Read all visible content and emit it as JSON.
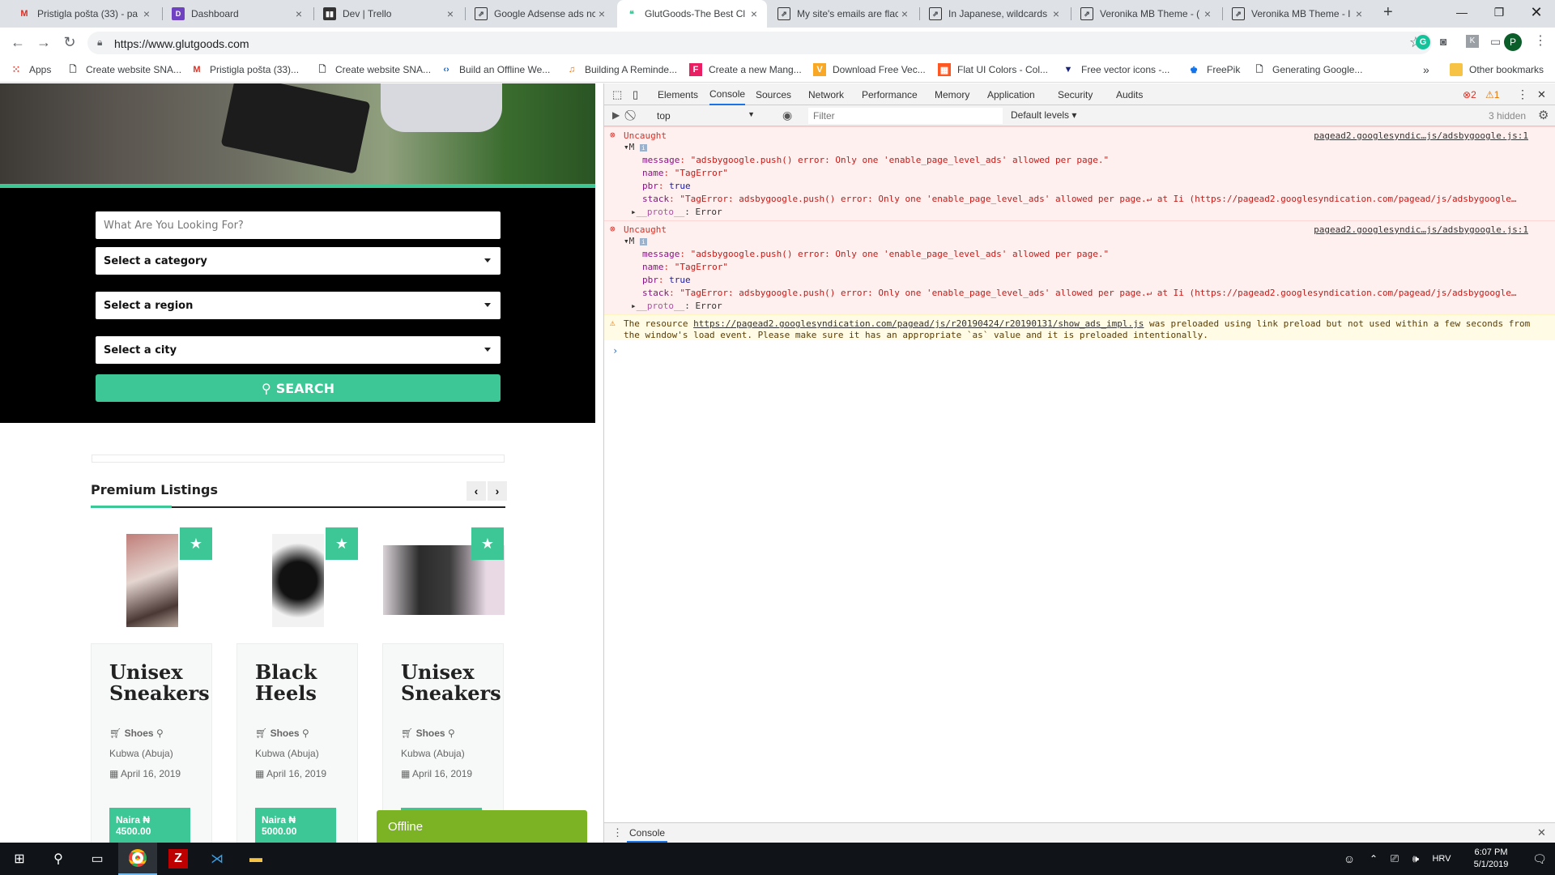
{
  "tabs": [
    {
      "title": "Pristigla pošta (33) - pa",
      "icon": "gmail-icon"
    },
    {
      "title": "Dashboard",
      "icon": "dashboard-icon"
    },
    {
      "title": "Dev | Trello",
      "icon": "trello-icon"
    },
    {
      "title": "Google Adsense ads nc",
      "icon": "stackexchange-icon"
    },
    {
      "title": "GlutGoods-The Best Cl",
      "icon": "glutgoods-icon"
    },
    {
      "title": "My site's emails are flac",
      "icon": "stackexchange-icon"
    },
    {
      "title": "In Japanese, wildcards a",
      "icon": "stackexchange-icon"
    },
    {
      "title": "Veronika MB Theme - (",
      "icon": "stackexchange-icon"
    },
    {
      "title": "Veronika MB Theme - I",
      "icon": "stackexchange-icon"
    }
  ],
  "browser": {
    "url": "https://www.glutgoods.com",
    "profile_initial": "P"
  },
  "bookmarks": [
    {
      "label": "Apps"
    },
    {
      "label": "Create website SNA..."
    },
    {
      "label": "Pristigla pošta (33)..."
    },
    {
      "label": "Create website SNA..."
    },
    {
      "label": "Build an Offline We..."
    },
    {
      "label": "Building A Reminde..."
    },
    {
      "label": "Create a new Mang..."
    },
    {
      "label": "Download Free Vec..."
    },
    {
      "label": "Flat UI Colors - Col..."
    },
    {
      "label": "Free vector icons -..."
    },
    {
      "label": "FreePik"
    },
    {
      "label": "Generating Google..."
    },
    {
      "label": "Other bookmarks"
    }
  ],
  "search": {
    "placeholder": "What Are You Looking For?",
    "category": "Select a category",
    "region": "Select a region",
    "city": "Select a city",
    "button": "SEARCH"
  },
  "premium": {
    "title": "Premium Listings",
    "cards": [
      {
        "title": "Unisex Sneakers",
        "category": "Shoes",
        "location": "Kubwa (Abuja)",
        "date": "April 16, 2019",
        "price": "Naira ₦ 4500.00"
      },
      {
        "title": "Black Heels",
        "category": "Shoes",
        "location": "Kubwa (Abuja)",
        "date": "April 16, 2019",
        "price": "Naira ₦ 5000.00"
      },
      {
        "title": "Unisex Sneakers",
        "category": "Shoes",
        "location": "Kubwa (Abuja)",
        "date": "April 16, 2019",
        "price": ""
      }
    ]
  },
  "offline": "Offline",
  "devtools": {
    "tabs": [
      "Elements",
      "Console",
      "Sources",
      "Network",
      "Performance",
      "Memory",
      "Application",
      "Security",
      "Audits"
    ],
    "errors_count": "2",
    "warnings_count": "1",
    "context": "top",
    "filter_placeholder": "Filter",
    "levels": "Default levels",
    "hidden": "3 hidden",
    "drawer_tab": "Console",
    "errors": [
      {
        "label": "Uncaught",
        "source": "pagead2.googlesyndic…js/adsbygoogle.js:1",
        "obj": "M",
        "message_key": "message",
        "message": "\"adsbygoogle.push() error: Only one 'enable_page_level_ads' allowed per page.\"",
        "name_key": "name",
        "name": "\"TagError\"",
        "pbr_key": "pbr",
        "pbr": "true",
        "stack_key": "stack",
        "stack": "\"TagError: adsbygoogle.push() error: Only one 'enable_page_level_ads' allowed per page.↵    at Ii (https://pagead2.googlesyndication.com/pagead/js/adsbygoogle…",
        "proto_key": "__proto__",
        "proto": "Error"
      },
      {
        "label": "Uncaught",
        "source": "pagead2.googlesyndic…js/adsbygoogle.js:1",
        "obj": "M",
        "message_key": "message",
        "message": "\"adsbygoogle.push() error: Only one 'enable_page_level_ads' allowed per page.\"",
        "name_key": "name",
        "name": "\"TagError\"",
        "pbr_key": "pbr",
        "pbr": "true",
        "stack_key": "stack",
        "stack": "\"TagError: adsbygoogle.push() error: Only one 'enable_page_level_ads' allowed per page.↵    at Ii (https://pagead2.googlesyndication.com/pagead/js/adsbygoogle…",
        "proto_key": "__proto__",
        "proto": "Error"
      }
    ],
    "warning": {
      "prefix": "The resource ",
      "link": "https://pagead2.googlesyndication.com/pagead/js/r20190424/r20190131/show_ads_impl.js",
      "suffix": " was preloaded using link preload but not used within a few seconds from",
      "line2": "the window's load event. Please make sure it has an appropriate `as` value and it is preloaded intentionally."
    }
  },
  "taskbar": {
    "lang": "HRV",
    "time": "6:07 PM",
    "date": "5/1/2019"
  },
  "colors": {
    "accent": "#3ec796",
    "offline": "#7cb324",
    "error_bg": "#fff0f0",
    "warning_bg": "#fffbe5"
  }
}
